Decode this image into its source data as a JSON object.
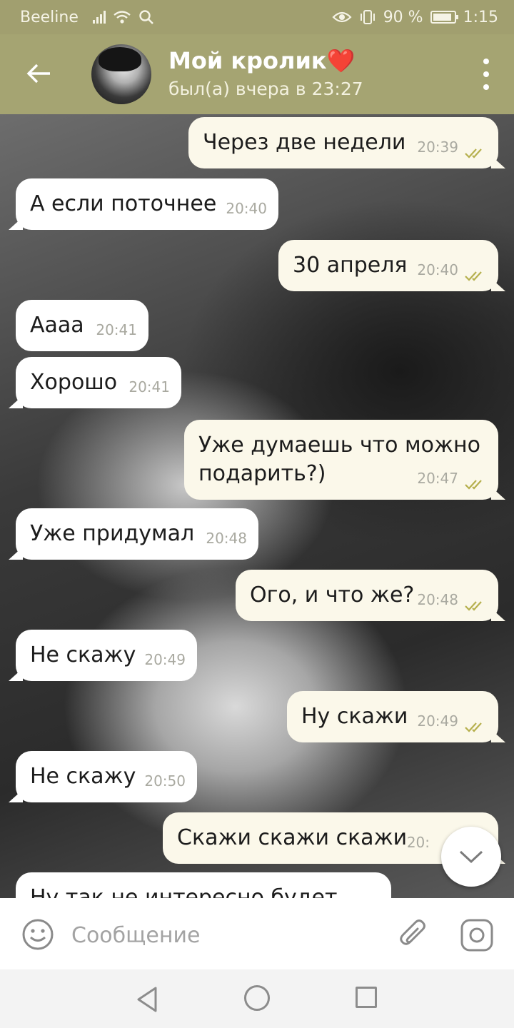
{
  "status_bar": {
    "carrier": "Beeline",
    "battery_percent": "90 %",
    "battery_level": 0.9,
    "time": "1:15",
    "icons": [
      "signal-icon",
      "wifi-icon",
      "search-icon",
      "eye-icon",
      "vibrate-icon",
      "battery-icon"
    ]
  },
  "header": {
    "contact_name": "Мой кролик❤️",
    "last_seen": "был(а) вчера в 23:27",
    "back_icon": "arrow-left-icon",
    "menu_icon": "more-vertical-icon"
  },
  "messages": [
    {
      "text": "Через две недели",
      "time": "20:39",
      "direction": "out",
      "read": true
    },
    {
      "text": "А если поточнее",
      "time": "20:40",
      "direction": "in"
    },
    {
      "text": "30 апреля",
      "time": "20:40",
      "direction": "out",
      "read": true
    },
    {
      "text": "Аааа",
      "time": "20:41",
      "direction": "in"
    },
    {
      "text": "Хорошо",
      "time": "20:41",
      "direction": "in"
    },
    {
      "text": "Уже думаешь что можно подарить?)",
      "time": "20:47",
      "direction": "out",
      "read": true
    },
    {
      "text": "Уже придумал",
      "time": "20:48",
      "direction": "in"
    },
    {
      "text": "Ого, и что же?",
      "time": "20:48",
      "direction": "out",
      "read": true
    },
    {
      "text": "Не скажу",
      "time": "20:49",
      "direction": "in"
    },
    {
      "text": "Ну скажи",
      "time": "20:49",
      "direction": "out",
      "read": true
    },
    {
      "text": "Не скажу",
      "time": "20:50",
      "direction": "in"
    },
    {
      "text": "Скажи скажи скажи",
      "time": "20:",
      "direction": "out"
    },
    {
      "text": "Ну так не интересно будет",
      "time": "",
      "direction": "in"
    }
  ],
  "input": {
    "placeholder": "Сообщение",
    "value": "",
    "emoji_icon": "smile-icon",
    "attach_icon": "paperclip-icon",
    "camera_icon": "camera-icon"
  },
  "scroll_button_icon": "chevron-down-icon",
  "colors": {
    "header_bg": "#a5a472",
    "status_bg": "#a19f6f",
    "bubble_in": "#ffffff",
    "bubble_out": "#fbf8ea",
    "check": "#b6b04e"
  }
}
